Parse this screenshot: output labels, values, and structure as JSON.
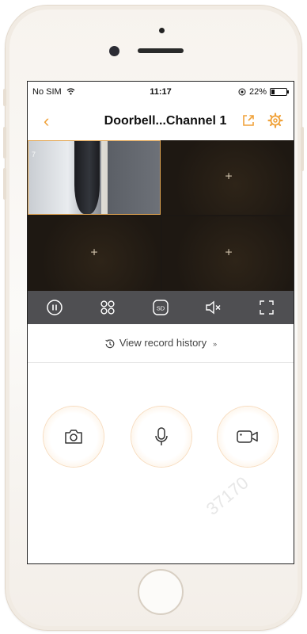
{
  "status_bar": {
    "carrier": "No SIM",
    "time": "11:17",
    "battery": "22%",
    "battery_level": 0.22
  },
  "nav": {
    "back_icon": "chevron-left-icon",
    "title": "Doorbell...Channel 1",
    "share_icon": "share-icon",
    "settings_icon": "gear-icon"
  },
  "video": {
    "active_timestamp": "7",
    "empty_tile_symbol": "+"
  },
  "controls": [
    {
      "name": "pause-button",
      "icon": "pause-icon"
    },
    {
      "name": "grid-layout-button",
      "icon": "grid-icon"
    },
    {
      "name": "quality-sd-button",
      "icon": "sd-icon",
      "label": "SD"
    },
    {
      "name": "mute-button",
      "icon": "speaker-muted-icon"
    },
    {
      "name": "fullscreen-button",
      "icon": "fullscreen-icon"
    }
  ],
  "history": {
    "label": "View record history",
    "icon": "history-clock-icon",
    "expand_icon": "chevron-double-down-icon"
  },
  "actions": [
    {
      "name": "snapshot-button",
      "icon": "camera-icon"
    },
    {
      "name": "talk-button",
      "icon": "microphone-icon"
    },
    {
      "name": "record-button",
      "icon": "video-record-icon"
    }
  ],
  "watermark": "37170",
  "colors": {
    "accent": "#f0a23a",
    "control_bar": "#4f4f52",
    "grid_bg": "#1c1713"
  }
}
